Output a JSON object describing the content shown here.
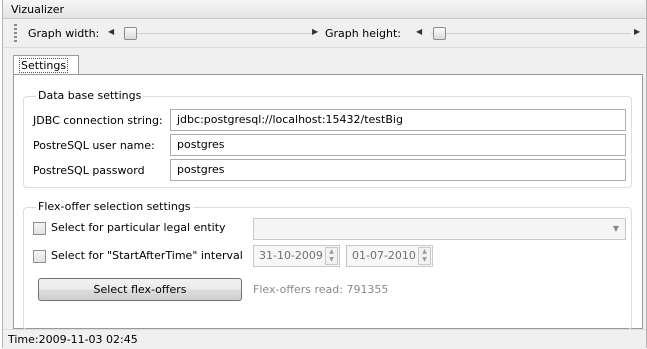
{
  "window": {
    "title": "Vizualizer"
  },
  "toolbar": {
    "graph_width_label": "Graph width:",
    "graph_height_label": "Graph height:",
    "graph_width_value": 0.02,
    "graph_height_value": 0.02
  },
  "tabs": [
    {
      "label": "Settings",
      "selected": true
    }
  ],
  "database_settings": {
    "title": "Data base settings",
    "jdbc_label": "JDBC connection string:",
    "jdbc_value": "jdbc:postgresql://localhost:15432/testBig",
    "user_label": "PostreSQL user name:",
    "user_value": "postgres",
    "password_label": "PostreSQL password",
    "password_value": "postgres"
  },
  "flexoffer_settings": {
    "title": "Flex-offer selection settings",
    "legal_entity_label": "Select for particular legal entity",
    "legal_entity_checked": false,
    "legal_entity_value": "",
    "interval_label": "Select for \"StartAfterTime\" interval",
    "interval_checked": false,
    "interval_from": "31-10-2009",
    "interval_to": "01-07-2010",
    "select_button": "Select flex-offers",
    "read_status": "Flex-offers read: 791355"
  },
  "status_bar": {
    "time_text": "Time:2009-11-03 02:45"
  },
  "icons": [
    "toolbar-grip-icon",
    "arrow-left-icon",
    "arrow-right-icon",
    "chevron-down-icon",
    "spin-up-icon",
    "spin-down-icon"
  ]
}
